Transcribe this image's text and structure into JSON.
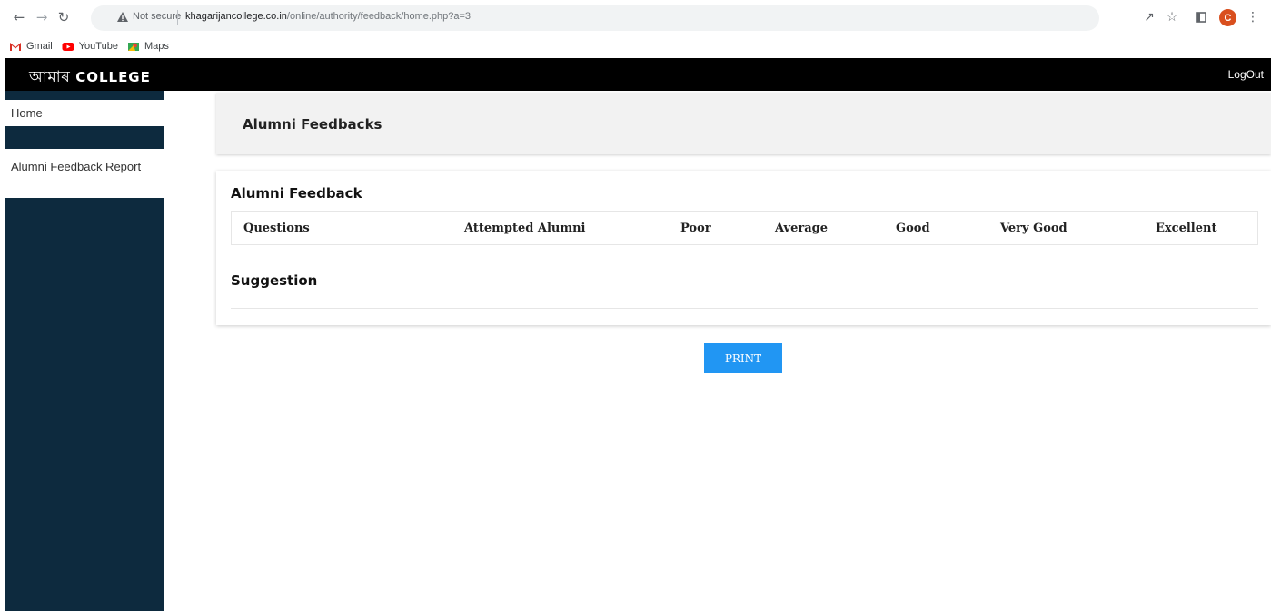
{
  "browser": {
    "security_label": "Not secure",
    "url_host": "khagarijancollege.co.in",
    "url_path": "/online/authority/feedback/home.php?a=3",
    "profile_initial": "C",
    "bookmarks": [
      {
        "label": "Gmail"
      },
      {
        "label": "YouTube"
      },
      {
        "label": "Maps"
      }
    ]
  },
  "app": {
    "brand_script": "আমাৰ",
    "brand_latin": "COLLEGE",
    "logout_label": "LogOut"
  },
  "sidebar": {
    "items": [
      {
        "label": "Home"
      },
      {
        "label": "Alumni Feedback Report"
      }
    ]
  },
  "main": {
    "page_title": "Alumni Feedbacks",
    "section_title": "Alumni Feedback",
    "table_headers": [
      "Questions",
      "Attempted Alumni",
      "Poor",
      "Average",
      "Good",
      "Very Good",
      "Excellent"
    ],
    "suggestion_title": "Suggestion",
    "print_label": "PRINT"
  },
  "colors": {
    "topbar": "#000000",
    "sidebar": "#0d2a3e",
    "print_button": "#2196f3",
    "header_card": "#f2f2f2"
  }
}
